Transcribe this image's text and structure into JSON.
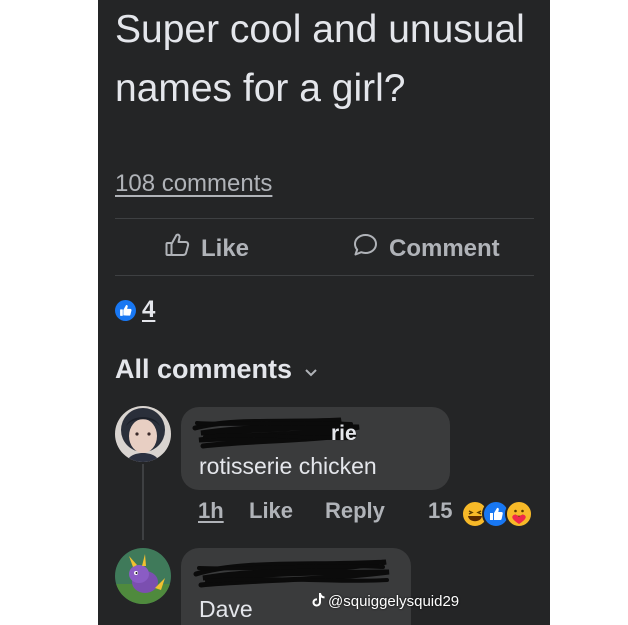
{
  "post": {
    "title": "Super cool and unusual names for a girl?",
    "comments_link": "108 comments"
  },
  "actions": {
    "like_label": "Like",
    "comment_label": "Comment"
  },
  "reactions": {
    "count": "4"
  },
  "comments_header": {
    "label": "All comments"
  },
  "comments": [
    {
      "author_visible": "rie",
      "text": "rotisserie chicken",
      "time": "1h",
      "like_label": "Like",
      "reply_label": "Reply",
      "reaction_count": "15"
    },
    {
      "text": "Dave"
    }
  ],
  "watermark": {
    "handle": "@squiggelysquid29"
  },
  "colors": {
    "background": "#242526",
    "bubble": "#3a3b3c",
    "primary_text": "#e4e6eb",
    "secondary_text": "#b0b3b8",
    "like_blue": "#1877f2"
  }
}
